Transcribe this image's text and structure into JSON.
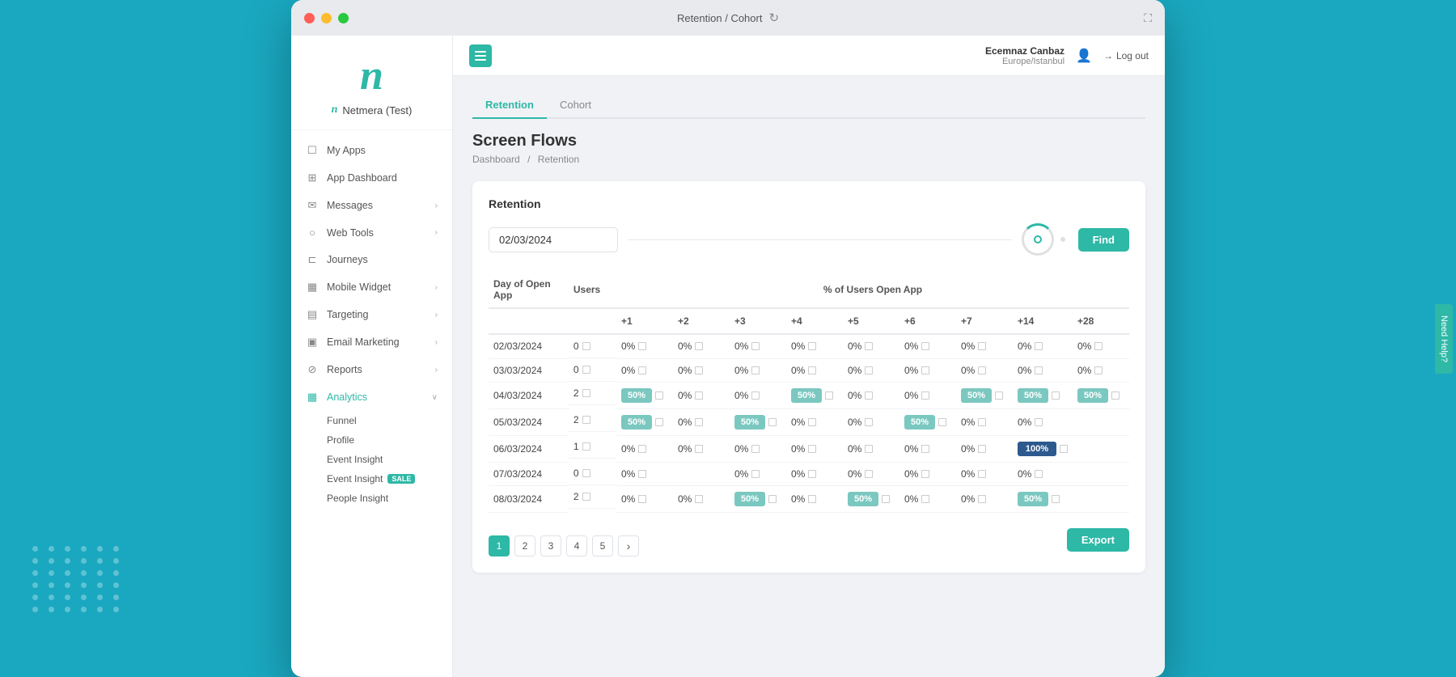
{
  "window": {
    "title": "Retention / Cohort",
    "expand_label": "⛶"
  },
  "sidebar": {
    "logo_letter": "n",
    "brand_name": "Netmera (Test)",
    "nav_items": [
      {
        "id": "my-apps",
        "label": "My Apps",
        "icon": "☐",
        "has_arrow": false
      },
      {
        "id": "app-dashboard",
        "label": "App Dashboard",
        "icon": "⊞",
        "has_arrow": false
      },
      {
        "id": "messages",
        "label": "Messages",
        "icon": "✉",
        "has_arrow": true
      },
      {
        "id": "web-tools",
        "label": "Web Tools",
        "icon": "○",
        "has_arrow": true
      },
      {
        "id": "journeys",
        "label": "Journeys",
        "icon": "⊏",
        "has_arrow": false
      },
      {
        "id": "mobile-widget",
        "label": "Mobile Widget",
        "icon": "▦",
        "has_arrow": true
      },
      {
        "id": "targeting",
        "label": "Targeting",
        "icon": "▤",
        "has_arrow": true
      },
      {
        "id": "email-marketing",
        "label": "Email Marketing",
        "icon": "▣",
        "has_arrow": true
      },
      {
        "id": "reports",
        "label": "Reports",
        "icon": "⊘",
        "has_arrow": true
      },
      {
        "id": "analytics",
        "label": "Analytics",
        "icon": "▦",
        "has_arrow": true,
        "expanded": true
      }
    ],
    "analytics_sub_items": [
      {
        "id": "funnel",
        "label": "Funnel",
        "has_badge": false
      },
      {
        "id": "profile",
        "label": "Profile",
        "has_badge": false
      },
      {
        "id": "event-insight-1",
        "label": "Event Insight",
        "has_badge": false
      },
      {
        "id": "event-insight-2",
        "label": "Event Insight",
        "has_badge": true,
        "badge_text": "SALE"
      },
      {
        "id": "people-insight",
        "label": "People Insight",
        "has_badge": false
      }
    ]
  },
  "topbar": {
    "menu_icon_label": "menu",
    "user_name": "Ecemnaz Canbaz",
    "user_region": "Europe/Istanbul",
    "logout_label": "Log out"
  },
  "page": {
    "tabs": [
      {
        "id": "retention",
        "label": "Retention",
        "active": true
      },
      {
        "id": "cohort",
        "label": "Cohort",
        "active": false
      }
    ],
    "title": "Screen Flows",
    "breadcrumb": [
      "Dashboard",
      "Retention"
    ],
    "section_title": "Retention"
  },
  "filter": {
    "date_value": "02/03/2024",
    "find_label": "Find"
  },
  "table": {
    "headers": {
      "day": "Day of Open App",
      "users": "Users",
      "pct_label": "% of Users Open App",
      "plus1": "+1",
      "plus2": "+2",
      "plus3": "+3",
      "plus4": "+4",
      "plus5": "+5",
      "plus6": "+6",
      "plus7": "+7",
      "plus14": "+14",
      "plus28": "+28"
    },
    "rows": [
      {
        "date": "02/03/2024",
        "users": "0",
        "plus1": "0%",
        "plus1_type": "zero",
        "plus2": "0%",
        "plus2_type": "zero",
        "plus3": "0%",
        "plus3_type": "zero",
        "plus4": "0%",
        "plus4_type": "zero",
        "plus5": "0%",
        "plus5_type": "zero",
        "plus6": "0%",
        "plus6_type": "zero",
        "plus7": "0%",
        "plus7_type": "zero",
        "plus14": "0%",
        "plus14_type": "zero",
        "plus28": "0%",
        "plus28_type": "zero"
      },
      {
        "date": "03/03/2024",
        "users": "0",
        "plus1": "0%",
        "plus1_type": "zero",
        "plus2": "0%",
        "plus2_type": "zero",
        "plus3": "0%",
        "plus3_type": "zero",
        "plus4": "0%",
        "plus4_type": "zero",
        "plus5": "0%",
        "plus5_type": "zero",
        "plus6": "0%",
        "plus6_type": "zero",
        "plus7": "0%",
        "plus7_type": "zero",
        "plus14": "0%",
        "plus14_type": "zero",
        "plus28": "0%",
        "plus28_type": "zero"
      },
      {
        "date": "04/03/2024",
        "users": "2",
        "plus1": "50%",
        "plus1_type": "light",
        "plus2": "0%",
        "plus2_type": "zero",
        "plus3": "0%",
        "plus3_type": "zero",
        "plus4": "50%",
        "plus4_type": "light",
        "plus5": "0%",
        "plus5_type": "zero",
        "plus6": "0%",
        "plus6_type": "zero",
        "plus7": "50%",
        "plus7_type": "light",
        "plus14": "50%",
        "plus14_type": "light",
        "plus28": "50%",
        "plus28_type": "light"
      },
      {
        "date": "05/03/2024",
        "users": "2",
        "plus1": "50%",
        "plus1_type": "light",
        "plus2": "0%",
        "plus2_type": "zero",
        "plus3": "50%",
        "plus3_type": "light",
        "plus4": "0%",
        "plus4_type": "zero",
        "plus5": "0%",
        "plus5_type": "zero",
        "plus6": "50%",
        "plus6_type": "light",
        "plus7": "0%",
        "plus7_type": "zero",
        "plus14": "0%",
        "plus14_type": "zero",
        "plus28": "",
        "plus28_type": "empty"
      },
      {
        "date": "06/03/2024",
        "users": "1",
        "plus1": "0%",
        "plus1_type": "zero",
        "plus2": "0%",
        "plus2_type": "zero",
        "plus3": "0%",
        "plus3_type": "zero",
        "plus4": "0%",
        "plus4_type": "zero",
        "plus5": "0%",
        "plus5_type": "zero",
        "plus6": "0%",
        "plus6_type": "zero",
        "plus7": "0%",
        "plus7_type": "zero",
        "plus14": "100%",
        "plus14_type": "dark",
        "plus28": "",
        "plus28_type": "empty"
      },
      {
        "date": "07/03/2024",
        "users": "0",
        "plus1": "0%",
        "plus1_type": "zero",
        "plus2": "",
        "plus2_type": "empty",
        "plus3": "0%",
        "plus3_type": "zero",
        "plus4": "0%",
        "plus4_type": "zero",
        "plus5": "0%",
        "plus5_type": "zero",
        "plus6": "0%",
        "plus6_type": "zero",
        "plus7": "0%",
        "plus7_type": "zero",
        "plus14": "0%",
        "plus14_type": "zero",
        "plus28": "",
        "plus28_type": "empty"
      },
      {
        "date": "08/03/2024",
        "users": "2",
        "plus1": "0%",
        "plus1_type": "zero",
        "plus2": "0%",
        "plus2_type": "zero",
        "plus3": "50%",
        "plus3_type": "light",
        "plus4": "0%",
        "plus4_type": "zero",
        "plus5": "50%",
        "plus5_type": "light",
        "plus6": "0%",
        "plus6_type": "zero",
        "plus7": "0%",
        "plus7_type": "zero",
        "plus14": "50%",
        "plus14_type": "light",
        "plus28": "",
        "plus28_type": "empty"
      }
    ]
  },
  "pagination": {
    "pages": [
      "1",
      "2",
      "3",
      "4",
      "5"
    ],
    "active_page": "1",
    "next_label": "›"
  },
  "export_label": "Export",
  "need_help_label": "Need Help?"
}
